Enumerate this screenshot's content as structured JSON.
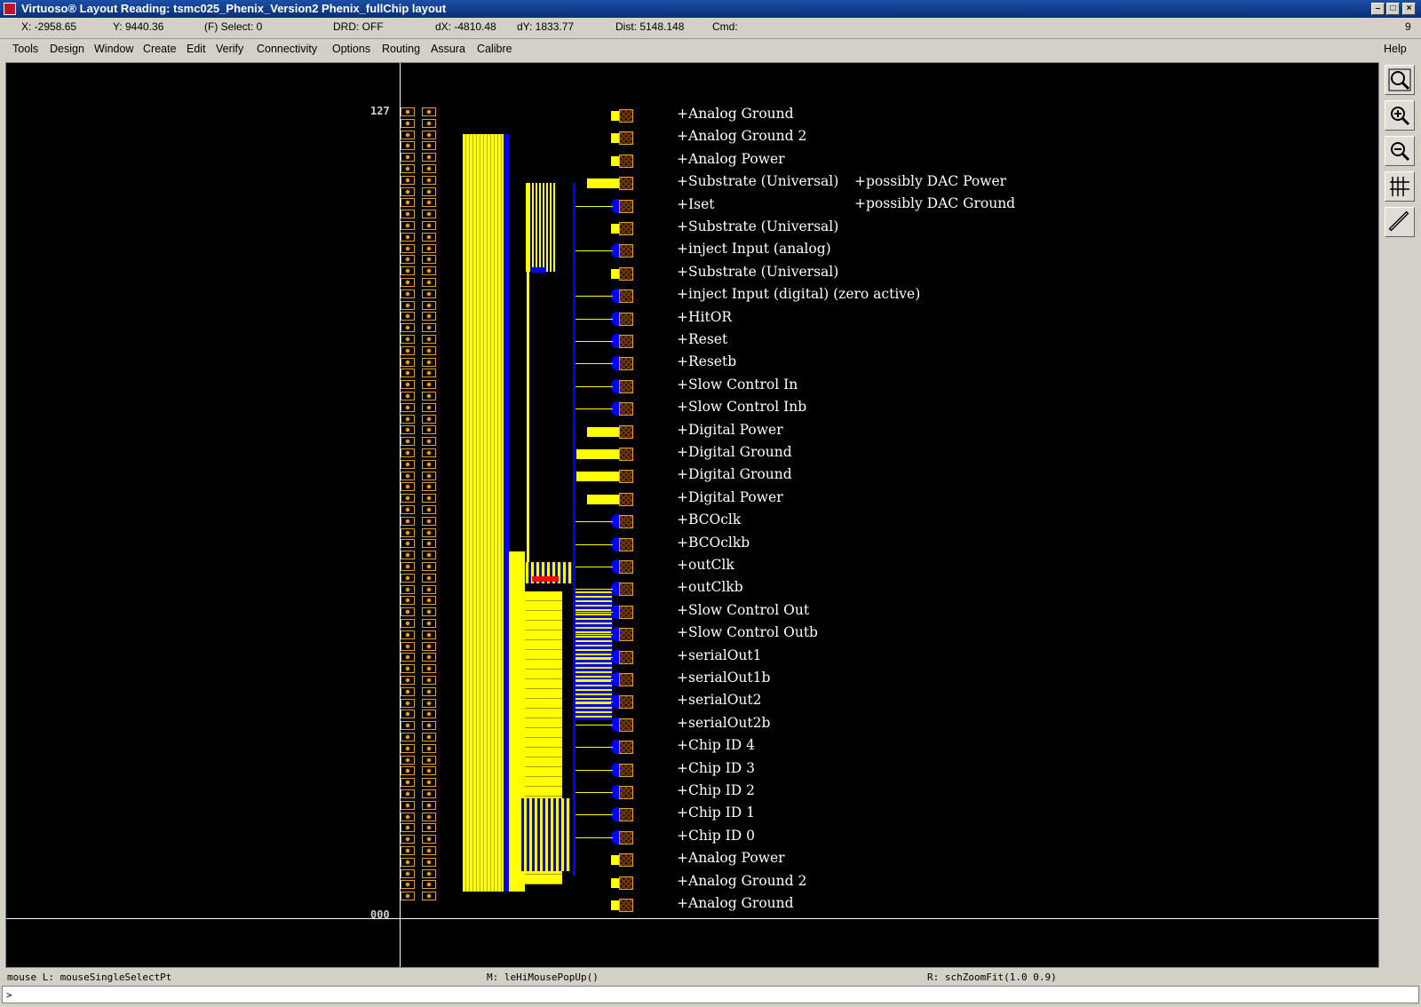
{
  "window": {
    "title": "Virtuoso® Layout Reading: tsmc025_Phenix_Version2 Phenix_fullChip layout"
  },
  "coords": {
    "x": "X: -2958.65",
    "y": "Y: 9440.36",
    "select": "(F) Select: 0",
    "drd": "DRD: OFF",
    "dx": "dX: -4810.48",
    "dy": "dY: 1833.77",
    "dist": "Dist: 5148.148",
    "cmd": "Cmd:",
    "count": "9"
  },
  "menu": {
    "items": [
      "Tools",
      "Design",
      "Window",
      "Create",
      "Edit",
      "Verify",
      "Connectivity",
      "Options",
      "Routing",
      "Assura",
      "Calibre"
    ],
    "help": "Help"
  },
  "toolbar": {
    "icons": [
      "zoom-fit-icon",
      "zoom-in-icon",
      "zoom-out-icon",
      "ruler-stack-icon",
      "ruler-icon"
    ]
  },
  "layout": {
    "axis_top": "127",
    "axis_bottom": "000",
    "pins": [
      "Analog Ground",
      "Analog Ground 2",
      "Analog Power",
      "Substrate (Universal)",
      "Iset",
      "Substrate (Universal)",
      "inject Input (analog)",
      "Substrate (Universal)",
      "inject Input (digital) (zero active)",
      "HitOR",
      "Reset",
      "Resetb",
      "Slow Control In",
      "Slow Control Inb",
      "Digital Power",
      "Digital Ground",
      "Digital Ground",
      "Digital Power",
      "BCOclk",
      "BCOclkb",
      "outClk",
      "outClkb",
      "Slow Control Out",
      "Slow Control Outb",
      "serialOut1",
      "serialOut1b",
      "serialOut2",
      "serialOut2b",
      "Chip ID 4",
      "Chip ID 3",
      "Chip ID 2",
      "Chip ID 1",
      "Chip ID 0",
      "Analog Power",
      "Analog Ground 2",
      "Analog Ground"
    ],
    "pad_types": [
      "small",
      "small",
      "diamond",
      "wide",
      "blue",
      "small",
      "blue",
      "small",
      "blue",
      "blue",
      "blue",
      "blue",
      "blue",
      "blue",
      "wide",
      "xwide",
      "xwide",
      "wide",
      "blue",
      "blue",
      "blue",
      "blue",
      "blue",
      "blue",
      "blue",
      "blue",
      "blue",
      "blue",
      "blue",
      "blue",
      "blue",
      "blue",
      "blue",
      "small",
      "small",
      "diamond"
    ],
    "extra_labels": [
      "possibly DAC Power",
      "possibly DAC Ground"
    ],
    "colors": {
      "yellow": "#ffff00",
      "blue": "#0000ff",
      "orange": "#e0a030",
      "red": "#ff0000",
      "white": "#ffffff"
    }
  },
  "status": {
    "mouse_l": "mouse L: mouseSingleSelectPt",
    "mouse_m": "M: leHiMousePopUp()",
    "mouse_r": "R: schZoomFit(1.0 0.9)",
    "prompt": ">"
  }
}
